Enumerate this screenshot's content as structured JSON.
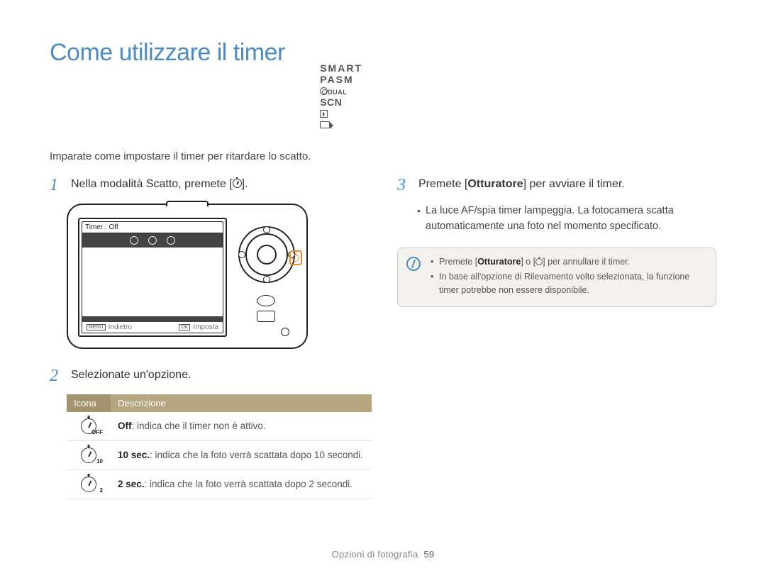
{
  "title": "Come utilizzare il timer",
  "mode_line": {
    "smart": "SMART",
    "p": "P",
    "a": "A",
    "s": "S",
    "m": "M",
    "dual": "DUAL",
    "scn": "SCN"
  },
  "intro": "Imparate come impostare il timer per ritardare lo scatto.",
  "steps": {
    "s1": {
      "num": "1",
      "text_before": "Nella modalità Scatto, premete [",
      "text_after": "]."
    },
    "s2": {
      "num": "2",
      "text": "Selezionate un'opzione."
    },
    "s3": {
      "num": "3",
      "text_before": "Premete [",
      "text_bold": "Otturatore",
      "text_after": "] per avviare il timer."
    }
  },
  "camera_lcd": {
    "header": "Timer : Off",
    "back_label": "Indietro",
    "back_key": "MENU",
    "set_label": "Imposta",
    "set_key": "OK"
  },
  "table": {
    "head_icon": "Icona",
    "head_desc": "Descrizione",
    "rows": [
      {
        "sub": "OFF",
        "bold": "Off",
        "rest": ": indica che il timer non è attivo."
      },
      {
        "sub": "10",
        "bold": "10 sec.",
        "rest": ": indica che la foto verrà scattata dopo 10 secondi."
      },
      {
        "sub": "2",
        "bold": "2 sec.",
        "rest": ": indica che la foto verrà scattata dopo 2 secondi."
      }
    ]
  },
  "right_bullet": "La luce AF/spia timer lampeggia. La fotocamera scatta automaticamente una foto nel momento specificato.",
  "note": {
    "line1_a": "Premete [",
    "line1_bold": "Otturatore",
    "line1_b": "] o [",
    "line1_c": "] per annullare il timer.",
    "line2": "In base all'opzione di Rilevamento volto selezionata, la funzione timer potrebbe non essere disponibile."
  },
  "footer": {
    "section": "Opzioni di fotografia",
    "page": "59"
  }
}
